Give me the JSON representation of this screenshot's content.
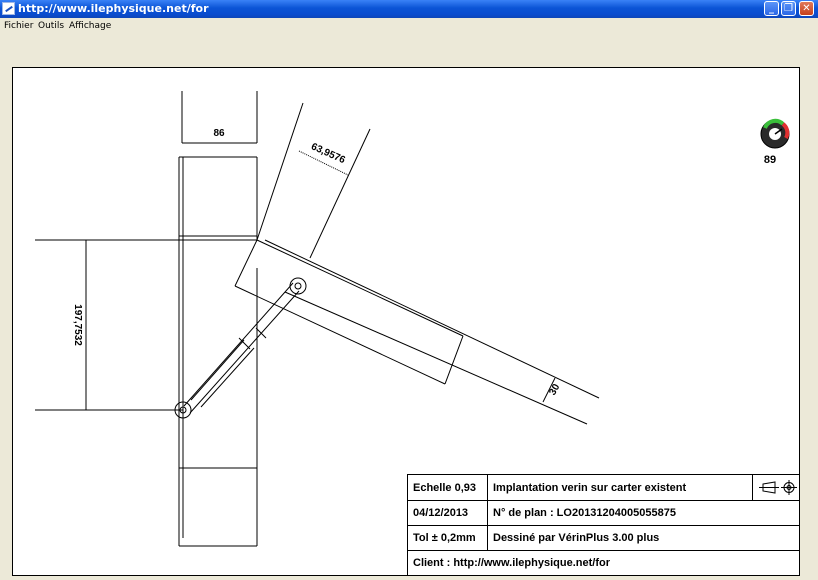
{
  "window": {
    "title": "http://www.ilephysique.net/for"
  },
  "menu": {
    "items": [
      "Fichier",
      "Outils",
      "Affichage"
    ]
  },
  "drawing": {
    "dim_top": "86",
    "dim_angled": "63,9576",
    "dim_vertical": "197,7532",
    "dim_rod": "30",
    "gauge_value": "89"
  },
  "title_block": {
    "scale": "Echelle 0,93",
    "title": "Implantation verin sur carter existent",
    "date": "04/12/2013",
    "plan_number": "N° de plan : LO20131204005055875",
    "tolerance": "Tol ± 0,2mm",
    "drawn_by": "Dessiné par VérinPlus 3.00 plus",
    "client": "Client : http://www.ilephysique.net/for"
  }
}
